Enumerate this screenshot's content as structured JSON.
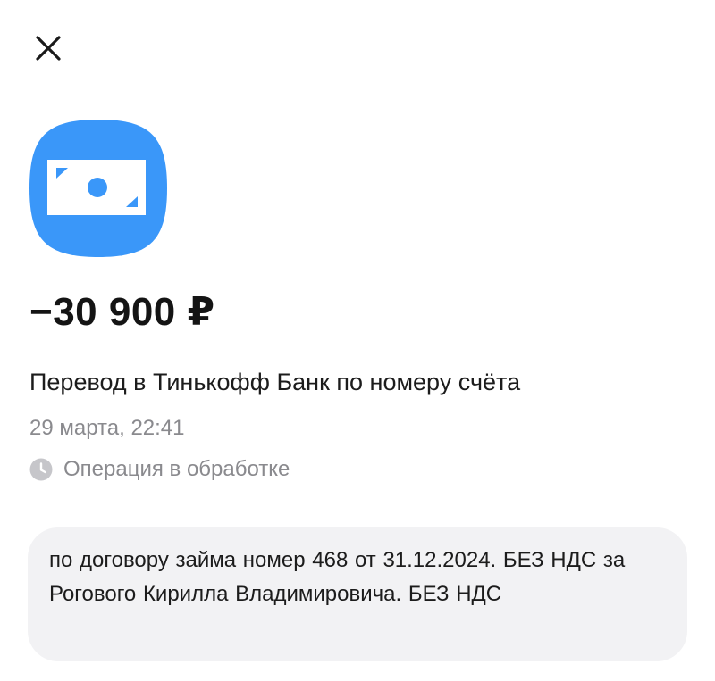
{
  "header": {
    "close_icon": "close-icon"
  },
  "operation": {
    "icon": "cash-transfer-icon",
    "icon_color": "#3a97f9",
    "amount": "−30 900 ₽",
    "title": "Перевод в Тинькофф Банк по номеру счёта",
    "datetime": "29 марта, 22:41",
    "status_icon": "clock-icon",
    "status": "Операция в обработке"
  },
  "comment": {
    "text": "по договору займа номер 468 от 31.12.2024. БЕЗ НДС за Рогового Кирилла Владимировича. БЕЗ НДС"
  },
  "colors": {
    "accent": "#3a97f9",
    "secondary_text": "#8a8a8e",
    "card_background": "#f2f2f4"
  }
}
